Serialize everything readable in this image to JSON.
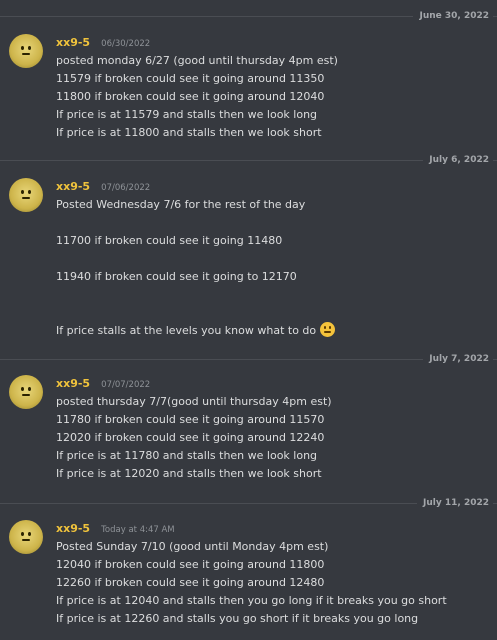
{
  "messages": [
    {
      "date": "June 30, 2022",
      "username": "xx9-5",
      "timestamp": "06/30/2022",
      "lines": [
        "posted monday 6/27 (good until thursday 4pm est)",
        "11579 if broken could see it going around 11350",
        "11800 if broken could see it going around 12040",
        "If price is at 11579 and stalls then we look long",
        "If price is at 11800 and stalls then we look short"
      ]
    },
    {
      "date": "July 6, 2022",
      "username": "xx9-5",
      "timestamp": "07/06/2022",
      "lines": [
        "Posted Wednesday 7/6 for the rest of the day",
        "",
        "11700 if broken could see it going 11480",
        "",
        "11940 if broken could see it going to 12170",
        "",
        "",
        "If price stalls at the levels you know what to do"
      ],
      "emoji": "slightly-smiling-face-icon"
    },
    {
      "date": "July 7, 2022",
      "username": "xx9-5",
      "timestamp": "07/07/2022",
      "lines": [
        "posted thursday 7/7(good until thursday 4pm est)",
        "11780 if broken could see it going around 11570",
        "12020 if broken could see it going around 12240",
        "If price is at 11780 and stalls then we look long",
        "If price is at 12020 and stalls then we look short"
      ]
    },
    {
      "date": "July 11, 2022",
      "username": "xx9-5",
      "timestamp": "Today at 4:47 AM",
      "lines": [
        "Posted Sunday 7/10 (good until Monday 4pm est)",
        "12040 if broken could see it going around 11800",
        "12260 if broken could see it going around 12480",
        "If price is at 12040 and stalls then you go long if it breaks you go short",
        "If price is at 12260 and stalls you go short if it breaks you go long"
      ]
    }
  ],
  "colors": {
    "background": "#36393f",
    "username": "#f0c33c",
    "text": "#dcddde",
    "timestamp": "#8e9297"
  }
}
